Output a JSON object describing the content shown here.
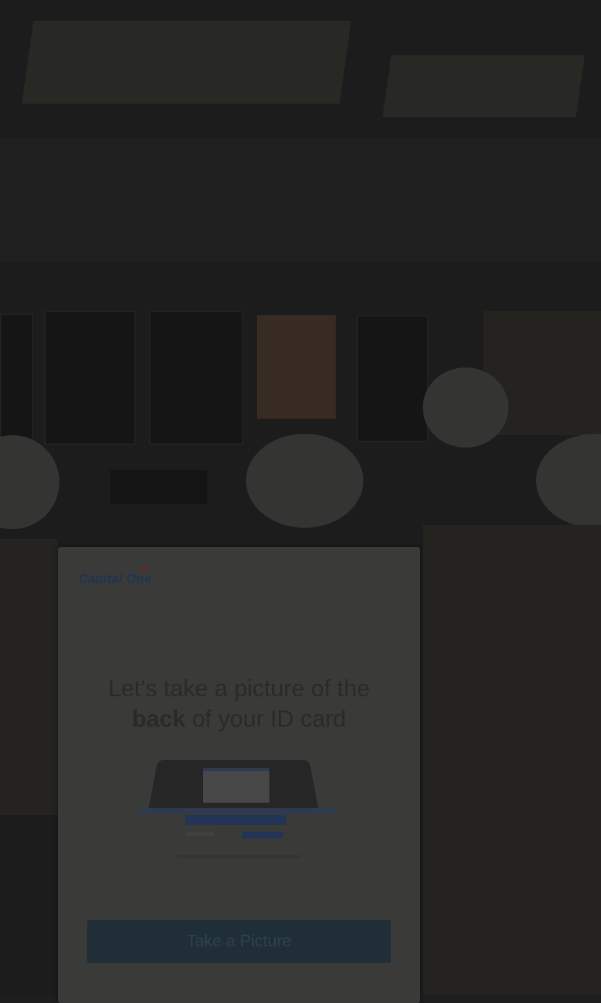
{
  "background": {
    "description_color": "#1d1e1d"
  },
  "card": {
    "logo_text": "Capital One",
    "title_prefix": "Let's take a picture of the ",
    "title_emphasis": "back",
    "title_suffix": " of your ID card",
    "button_label": "Take a Picture"
  },
  "colors": {
    "card_bg": "#3a3a39",
    "button_bg": "#1f2e37",
    "brand_navy": "#1e3552",
    "brand_red": "#6b2222"
  },
  "icons": [
    "capital-one-logo",
    "id-scanner-illustration"
  ]
}
